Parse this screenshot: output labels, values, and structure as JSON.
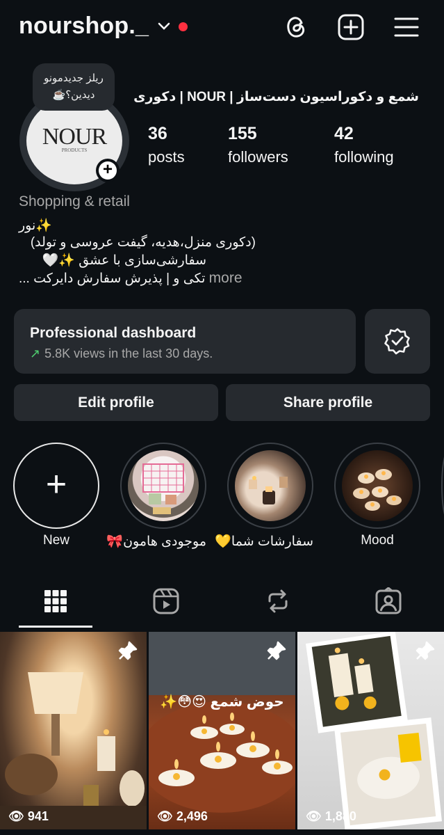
{
  "header": {
    "username": "nourshop._",
    "icons": [
      "chevron-down-icon",
      "threads-icon",
      "add-post-icon",
      "menu-icon"
    ],
    "notification_dot_color": "#ff3040"
  },
  "profile": {
    "note": "ریلز جدیدمونو دیدین؟☕️",
    "avatar_logo": "NOUR",
    "avatar_sub": "PRODUCTS",
    "display_name": "شمع و دکوراسیون دست‌ساز | NOUR | دکوری",
    "stats": [
      {
        "num": "36",
        "label": "posts"
      },
      {
        "num": "155",
        "label": "followers"
      },
      {
        "num": "42",
        "label": "following"
      }
    ],
    "category": "Shopping & retail",
    "bio": {
      "line1": "✨نور",
      "line2": "(دکوری منزل،هدیه، گیفت عروسی و تولد)",
      "line3": "سفارشی‌سازی با عشق ✨🤍",
      "line4": "تکی و | پذیرش سفارش دایرکت ...",
      "more": "more"
    }
  },
  "dashboard": {
    "title": "Professional dashboard",
    "subtitle": "5.8K views in the last 30 days.",
    "trend_color": "#4fcf70"
  },
  "buttons": {
    "edit": "Edit profile",
    "share": "Share profile"
  },
  "highlights": [
    {
      "label": "New"
    },
    {
      "label": "موجودی هامون🎀"
    },
    {
      "label": "سفارشات شما💛"
    },
    {
      "label": "Mood"
    }
  ],
  "tabs": [
    "grid-icon",
    "reels-icon",
    "reposts-icon",
    "tagged-icon"
  ],
  "posts": [
    {
      "views": "941",
      "title": ""
    },
    {
      "views": "2,496",
      "title": "حوض شمع 😍😳✨"
    },
    {
      "views": "1,880",
      "title": ""
    }
  ]
}
